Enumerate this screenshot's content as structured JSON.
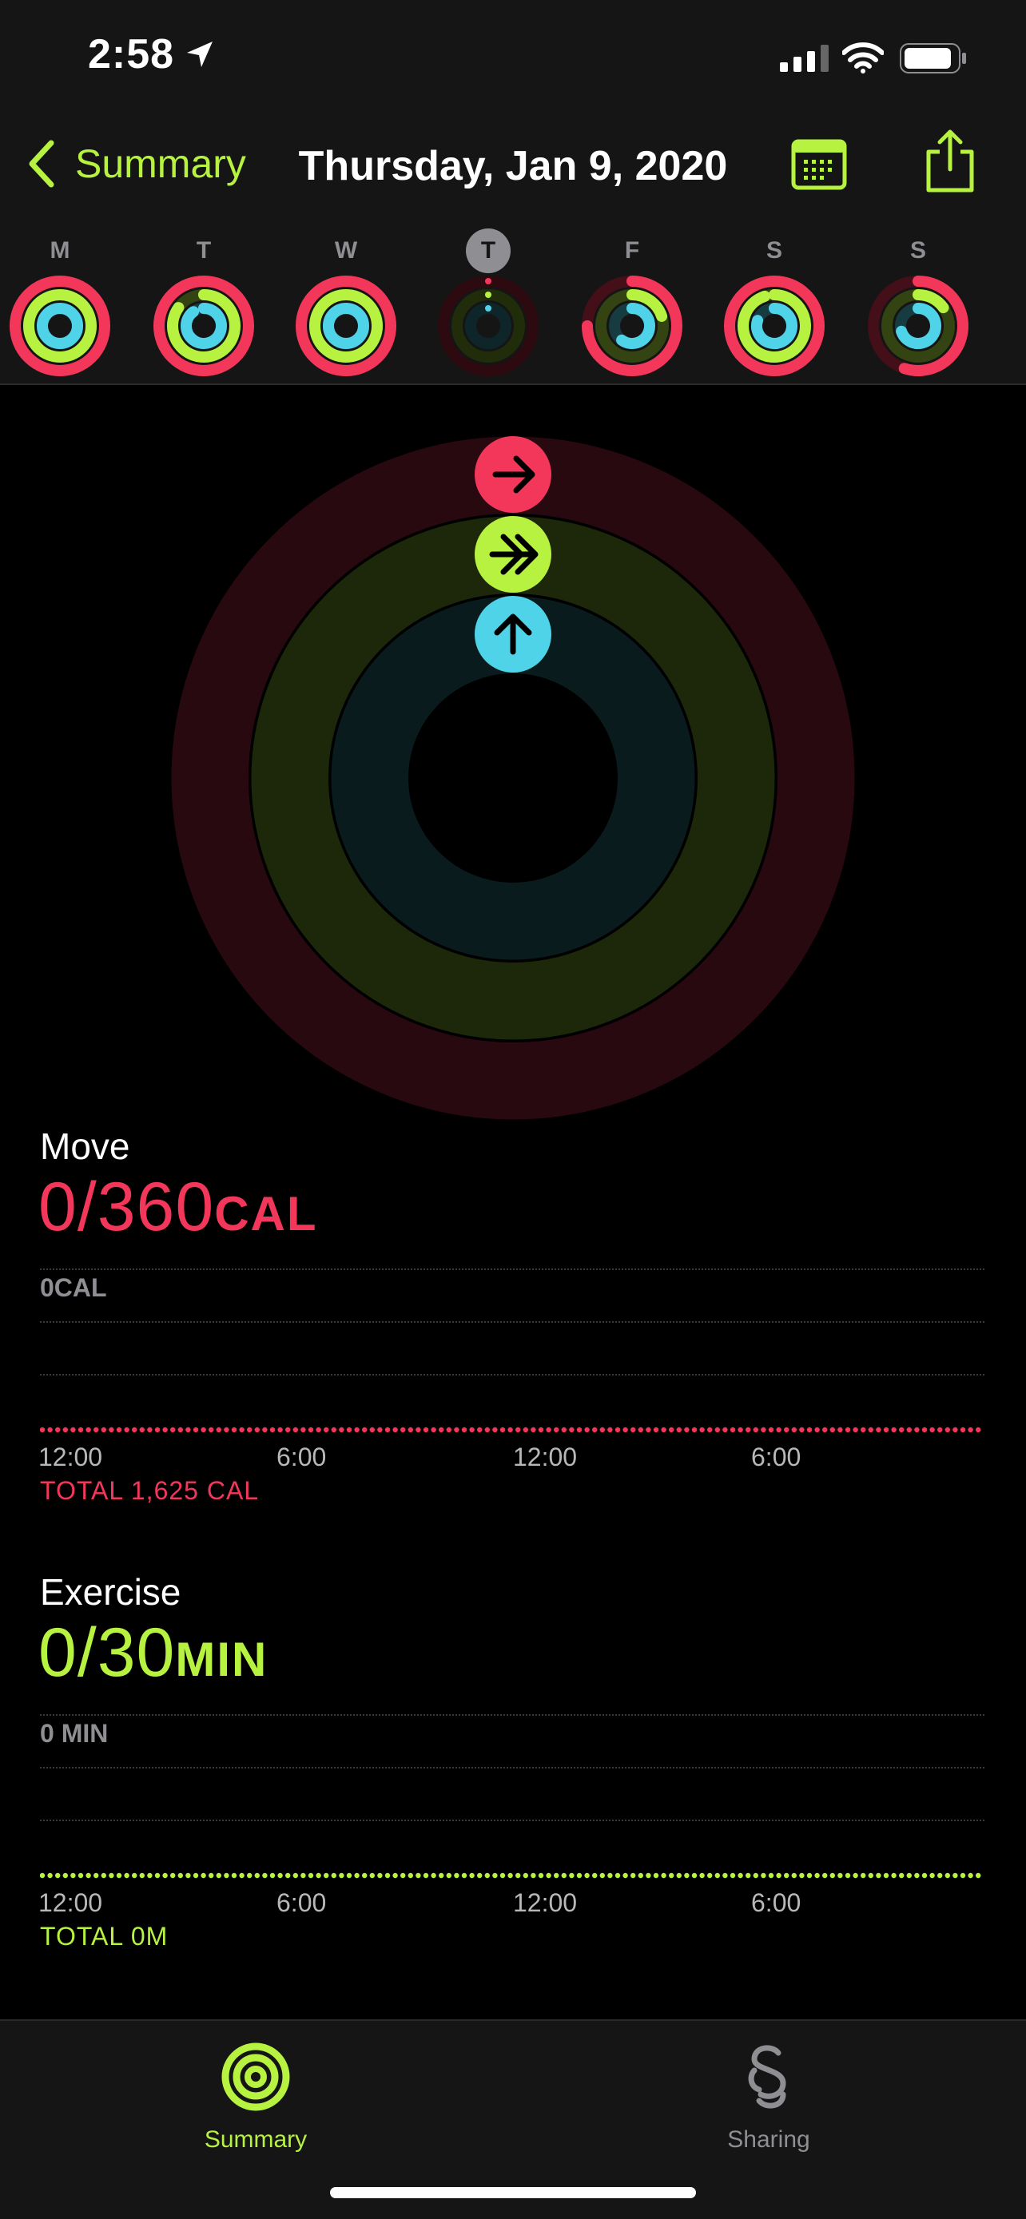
{
  "status_bar": {
    "time": "2:58"
  },
  "nav": {
    "back_label": "Summary",
    "title": "Thursday, Jan 9, 2020"
  },
  "week": [
    {
      "letter": "M",
      "selected": false,
      "move": 1.0,
      "exercise": 1.0,
      "stand": 1.0,
      "dim": false
    },
    {
      "letter": "T",
      "selected": false,
      "move": 1.0,
      "exercise": 0.85,
      "stand": 0.9,
      "dim": false
    },
    {
      "letter": "W",
      "selected": false,
      "move": 1.0,
      "exercise": 1.0,
      "stand": 1.0,
      "dim": false
    },
    {
      "letter": "T",
      "selected": true,
      "move": 0.0,
      "exercise": 0.0,
      "stand": 0.0,
      "dim": true
    },
    {
      "letter": "F",
      "selected": false,
      "move": 0.75,
      "exercise": 0.2,
      "stand": 0.6,
      "dim": false
    },
    {
      "letter": "S",
      "selected": false,
      "move": 1.0,
      "exercise": 0.95,
      "stand": 0.8,
      "dim": false
    },
    {
      "letter": "S",
      "selected": false,
      "move": 0.55,
      "exercise": 0.15,
      "stand": 0.7,
      "dim": false
    }
  ],
  "rings": {
    "move": 0,
    "exercise": 0,
    "stand": 0
  },
  "move": {
    "label": "Move",
    "value": "0/360",
    "unit": "CAL",
    "axis_max": "0CAL",
    "ticks": [
      "12:00",
      "6:00",
      "12:00",
      "6:00"
    ],
    "total": "TOTAL 1,625 CAL"
  },
  "exercise": {
    "label": "Exercise",
    "value": "0/30",
    "unit": "MIN",
    "axis_max": "0 MIN",
    "ticks": [
      "12:00",
      "6:00",
      "12:00",
      "6:00"
    ],
    "total": "TOTAL 0M"
  },
  "tabs": [
    {
      "label": "Summary",
      "active": true
    },
    {
      "label": "Sharing",
      "active": false
    }
  ],
  "colors": {
    "move": "#f3375b",
    "exercise": "#b6f23f",
    "stand": "#4fd3e8",
    "accent": "#b6f23f",
    "inactive": "#8e8e93"
  }
}
